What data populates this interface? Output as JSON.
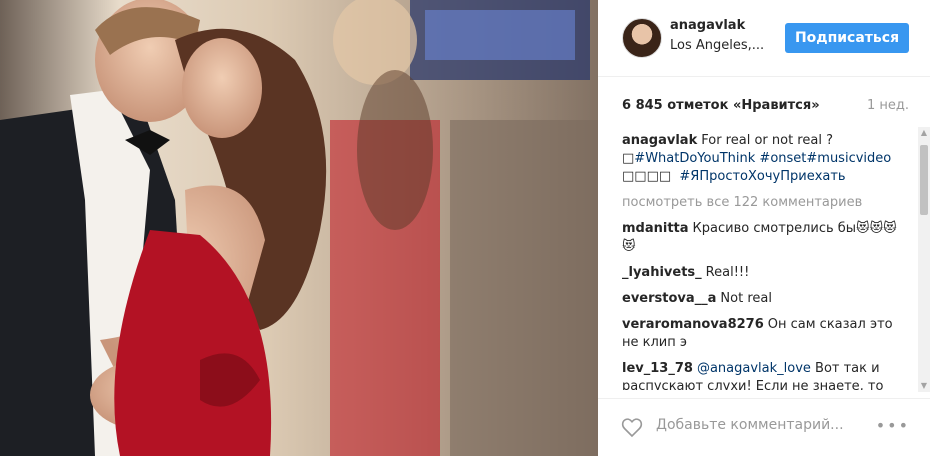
{
  "post": {
    "username": "anagavlak",
    "location": "Los Angeles,...",
    "follow_label": "Подписаться",
    "likes": "6 845 отметок «Нравится»",
    "time": "1 нед."
  },
  "caption": {
    "user": "anagavlak",
    "text_1": "For real or not real ?",
    "line_2_prefix": "□",
    "tag_1": "#WhatDoYouThink",
    "tag_2": "#onset",
    "tag_3": "#musicvideo",
    "line_3_prefix": "□□□□",
    "tag_4": "#ЯПростоХочуПриехать"
  },
  "view_all": "посмотреть все 122 комментариев",
  "comments": [
    {
      "user": "mdanitta",
      "text": "Красиво смотрелись бы😻😻😻😻"
    },
    {
      "user": "_lyahivets_",
      "text": "Real!!!"
    },
    {
      "user": "everstova__a",
      "text": "Not real"
    },
    {
      "user": "veraromanova8276",
      "text": "Он сам сказал это не клип э"
    },
    {
      "user": "lev_13_78",
      "mention": "@anagavlak_love",
      "text": "Вот так и распускают слухи! Если не знаете, то"
    }
  ],
  "footer": {
    "placeholder": "Добавьте комментарий...",
    "more": "•••"
  },
  "icons": {
    "heart": "heart-icon",
    "more": "more-options-icon",
    "scroll_up": "scroll-up-icon",
    "scroll_down": "scroll-down-icon"
  },
  "colors": {
    "accent": "#3897f0",
    "hashtag": "#003569",
    "muted": "#999999"
  }
}
